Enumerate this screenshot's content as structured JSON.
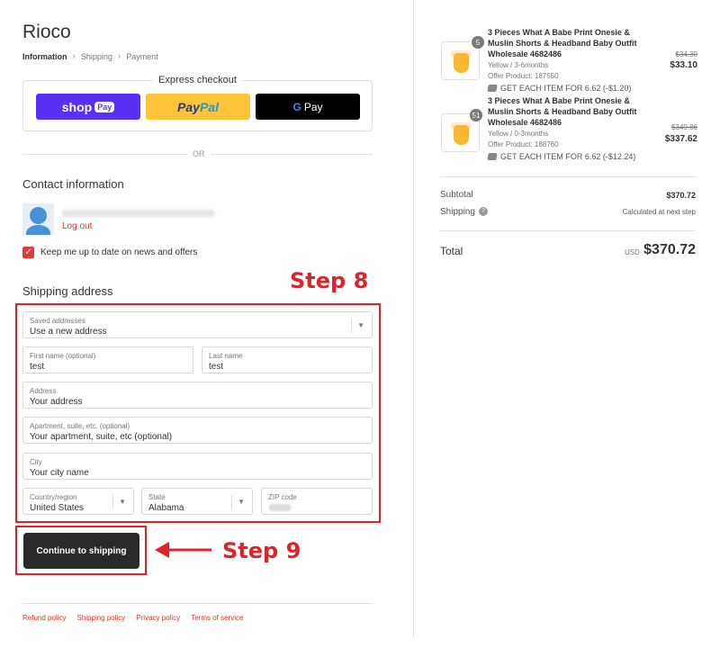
{
  "store": {
    "name": "Rioco"
  },
  "breadcrumb": {
    "items": [
      "Information",
      "Shipping",
      "Payment"
    ],
    "separator": ">"
  },
  "express": {
    "title": "Express checkout",
    "shop_pay": {
      "text": "shop",
      "pill": "Pay"
    },
    "paypal": {
      "text_a": "Pay",
      "text_b": "Pal"
    },
    "gpay": {
      "g": "G",
      "text": "Pay"
    }
  },
  "or_text": "OR",
  "contact": {
    "title": "Contact information",
    "logout": "Log out"
  },
  "newsletter": {
    "checked": true,
    "check_mark": "✓",
    "label": "Keep me up to date on news and offers"
  },
  "shipping": {
    "title": "Shipping address",
    "saved_addresses": {
      "label": "Saved addresses",
      "value": "Use a new address"
    },
    "first_name": {
      "label": "First name (optional)",
      "value": "test"
    },
    "last_name": {
      "label": "Last name",
      "value": "test"
    },
    "address": {
      "label": "Address",
      "placeholder": "Your address"
    },
    "apartment": {
      "label": "Apartment, suite, etc. (optional)",
      "placeholder": "Your apartment, suite, etc (optional)"
    },
    "city": {
      "label": "City",
      "placeholder": "Your city name"
    },
    "country": {
      "label": "Country/region",
      "value": "United States"
    },
    "state": {
      "label": "State",
      "value": "Alabama"
    },
    "zip": {
      "label": "ZIP code"
    }
  },
  "continue_button": "Continue to shipping",
  "annotations": {
    "step8": "Step 8",
    "step9": "Step 9",
    "color": "#e0232b"
  },
  "footer": {
    "links": [
      "Refund policy",
      "Shipping policy",
      "Privacy policy",
      "Terms of service"
    ]
  },
  "order": {
    "items": [
      {
        "qty": "5",
        "title": "3 Pieces What A Babe Print Onesie & Muslin Shorts & Headband Baby Outfit Wholesale 4682486",
        "variant": "Yellow / 3-6months",
        "offer": "Offer Product: 187550",
        "discount": "GET EACH ITEM FOR 6.62 (-$1.20)",
        "old_price": "$34.30",
        "price": "$33.10"
      },
      {
        "qty": "51",
        "title": "3 Pieces What A Babe Print Onesie & Muslin Shorts & Headband Baby Outfit Wholesale 4682486",
        "variant": "Yellow / 0-3months",
        "offer": "Offer Product: 188760",
        "discount": "GET EACH ITEM FOR 6.62 (-$12.24)",
        "old_price": "$349.86",
        "price": "$337.62"
      }
    ],
    "subtotal_label": "Subtotal",
    "subtotal_value": "$370.72",
    "shipping_label": "Shipping",
    "shipping_value": "Calculated at next step",
    "total_label": "Total",
    "currency": "USD",
    "total_value": "$370.72"
  }
}
